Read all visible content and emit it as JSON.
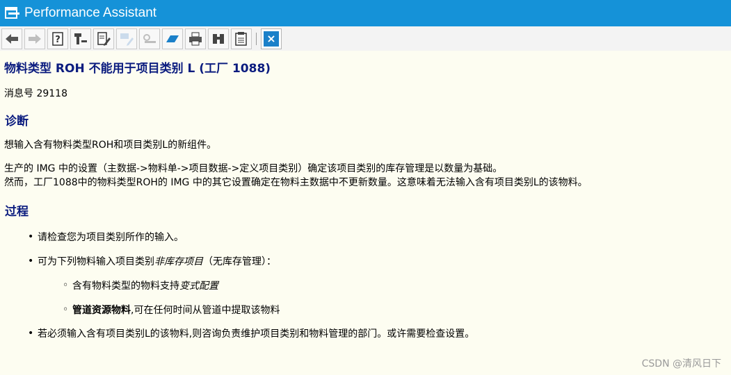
{
  "window": {
    "title": "Performance Assistant"
  },
  "toolbar": {
    "buttons": [
      {
        "name": "back-arrow-icon",
        "enabled": true
      },
      {
        "name": "forward-arrow-icon",
        "enabled": false
      },
      {
        "name": "help-document-icon",
        "enabled": true
      },
      {
        "name": "technical-info-icon",
        "enabled": true
      },
      {
        "name": "edit-document-icon",
        "enabled": true
      },
      {
        "name": "edit-disabled-icon",
        "enabled": false
      },
      {
        "name": "key-icon",
        "enabled": false
      },
      {
        "name": "bookmark-icon",
        "enabled": true
      },
      {
        "name": "print-icon",
        "enabled": true
      },
      {
        "name": "find-binoculars-icon",
        "enabled": true
      },
      {
        "name": "document-settings-icon",
        "enabled": true
      }
    ],
    "close_label": "×"
  },
  "message": {
    "heading": "物料类型 ROH 不能用于项目类别 L (工厂 1088)",
    "number": "消息号 29118"
  },
  "diagnosis": {
    "title": "诊断",
    "para1": "想输入含有物料类型ROH和项目类别L的新组件。",
    "para2_line1": "生产的 IMG 中的设置（主数据->物料单->项目数据->定义项目类别）确定该项目类别的库存管理是以数量为基础。",
    "para2_line2": "然而，工厂1088中的物料类型ROH的 IMG 中的其它设置确定在物料主数据中不更新数量。这意味着无法输入含有项目类别L的该物料。"
  },
  "procedure": {
    "title": "过程",
    "bullet1": "请检查您为项目类别所作的输入。",
    "bullet2_prefix": "可为下列物料输入项目类别",
    "bullet2_em": "非库存项目",
    "bullet2_suffix": "（无库存管理）：",
    "sub1_prefix": "含有物料类型的物料支持",
    "sub1_em": "变式配置",
    "sub2_strong": "管道资源物料",
    "sub2_suffix": ",可在任何时间从管道中提取该物料",
    "bullet3": "若必须输入含有项目类别L的该物料,则咨询负责维护项目类别和物料管理的部门。或许需要检查设置。"
  },
  "watermark": "CSDN @清风日下",
  "colors": {
    "titlebar": "#1592d8",
    "heading": "#0b1c7f",
    "background": "#fdfdf1"
  }
}
